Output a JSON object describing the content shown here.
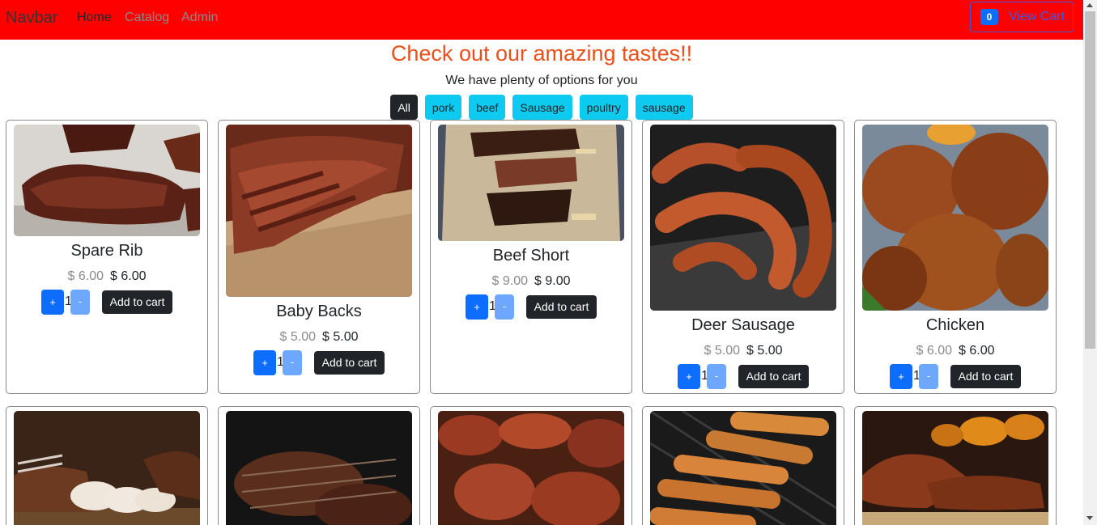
{
  "navbar": {
    "brand": "Navbar",
    "links": [
      "Home",
      "Catalog",
      "Admin"
    ],
    "cart_count": "0",
    "cart_label": "View Cart"
  },
  "header": {
    "title": "Check out our amazing tastes!!",
    "subtitle": "We have plenty of options for you"
  },
  "filters": [
    "All",
    "pork",
    "beef",
    "Sausage",
    "poultry",
    "sausage"
  ],
  "products": [
    {
      "name": "Spare Rib",
      "old_price": "$ 6.00",
      "price": "$ 6.00",
      "qty": "1",
      "plus": "+",
      "minus": "-",
      "add_label": "Add to cart"
    },
    {
      "name": "Baby Backs",
      "old_price": "$ 5.00",
      "price": "$ 5.00",
      "qty": "1",
      "plus": "+",
      "minus": "-",
      "add_label": "Add to cart"
    },
    {
      "name": "Beef Short",
      "old_price": "$ 9.00",
      "price": "$ 9.00",
      "qty": "1",
      "plus": "+",
      "minus": "-",
      "add_label": "Add to cart"
    },
    {
      "name": "Deer Sausage",
      "old_price": "$ 5.00",
      "price": "$ 5.00",
      "qty": "1",
      "plus": "+",
      "minus": "-",
      "add_label": "Add to cart"
    },
    {
      "name": "Chicken",
      "old_price": "$ 6.00",
      "price": "$ 6.00",
      "qty": "1",
      "plus": "+",
      "minus": "-",
      "add_label": "Add to cart"
    }
  ],
  "colors": {
    "navbar_bg": "#ff0000",
    "headline": "#e8501c",
    "filter_bg": "#0dcaf0",
    "primary": "#0d6efd",
    "dark": "#212529"
  }
}
